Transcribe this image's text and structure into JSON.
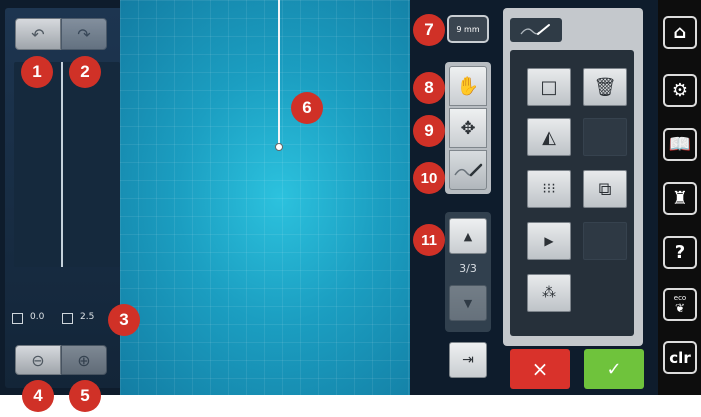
{
  "left_panel": {
    "undo_icon": "undo-arrow",
    "redo_icon": "redo-arrow",
    "position_x": "0.0",
    "position_y": "2.5",
    "zoom_out_icon": "zoom-out-magnifier",
    "zoom_in_icon": "zoom-in-magnifier"
  },
  "stitch_length": {
    "label": "9 mm"
  },
  "middle_tools": {
    "move_canvas_icon": "hand",
    "move_design_icon": "four-arrows",
    "draw_icon": "stitch-line"
  },
  "pager": {
    "text": "3/3"
  },
  "bottom_actions": {
    "cancel_label": "×",
    "confirm_label": "✓"
  },
  "right_sidebar": {
    "home_icon": "house",
    "settings_icon": "gears",
    "tutorial_icon": "open-book",
    "sewing_advisor_icon": "dress-form",
    "help_label": "?",
    "eco_label": "eco",
    "clr_label": "clr"
  },
  "callouts": [
    "1",
    "2",
    "3",
    "4",
    "5",
    "6",
    "7",
    "8",
    "9",
    "10",
    "11"
  ],
  "colors": {
    "canvas": "#1ea3c4",
    "badge": "#d03127",
    "cancel": "#d9322b",
    "confirm": "#6fc33c",
    "sidebar": "#0d0d0d"
  }
}
